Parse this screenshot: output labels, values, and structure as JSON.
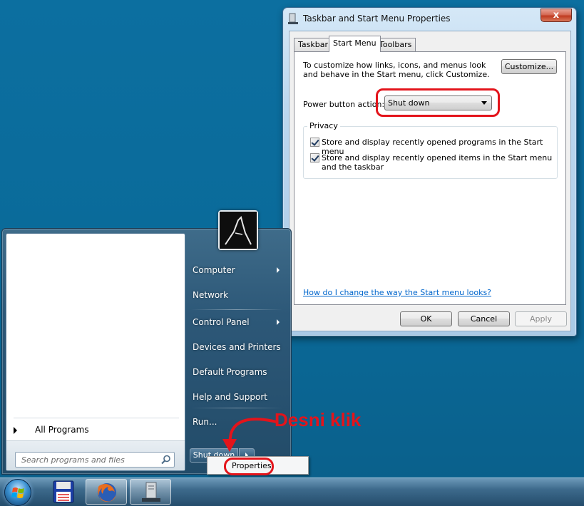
{
  "window": {
    "title": "Taskbar and Start Menu Properties",
    "close_label": "x",
    "tabs": [
      {
        "label": "Taskbar"
      },
      {
        "label": "Start Menu"
      },
      {
        "label": "Toolbars"
      }
    ],
    "description": "To customize how links, icons, and menus look and behave in the Start menu, click Customize.",
    "customize_label": "Customize...",
    "power_label": "Power button action:",
    "power_value": "Shut down",
    "privacy_title": "Privacy",
    "privacy_items": [
      {
        "label": "Store and display recently opened programs in the Start menu",
        "checked": true
      },
      {
        "label": "Store and display recently opened items in the Start menu and the taskbar",
        "checked": true
      }
    ],
    "help_link": "How do I change the way the Start menu looks?",
    "ok_label": "OK",
    "cancel_label": "Cancel",
    "apply_label": "Apply"
  },
  "start_menu": {
    "all_programs": "All Programs",
    "search_placeholder": "Search programs and files",
    "right_items": [
      {
        "label": "Computer",
        "has_arrow": true
      },
      {
        "label": "Network",
        "has_arrow": false
      },
      {
        "label": "Control Panel",
        "has_arrow": true
      },
      {
        "label": "Devices and Printers",
        "has_arrow": false
      },
      {
        "label": "Default Programs",
        "has_arrow": false
      },
      {
        "label": "Help and Support",
        "has_arrow": false
      },
      {
        "label": "Run...",
        "has_arrow": false
      }
    ],
    "shutdown_label": "Shut down",
    "context_menu_item": "Properties"
  },
  "annotation": {
    "text": "Desni klik",
    "color": "#e3141b"
  },
  "taskbar": {
    "items": [
      {
        "icon": "floppy-disk-icon"
      },
      {
        "icon": "firefox-icon"
      },
      {
        "icon": "server-icon"
      }
    ]
  }
}
